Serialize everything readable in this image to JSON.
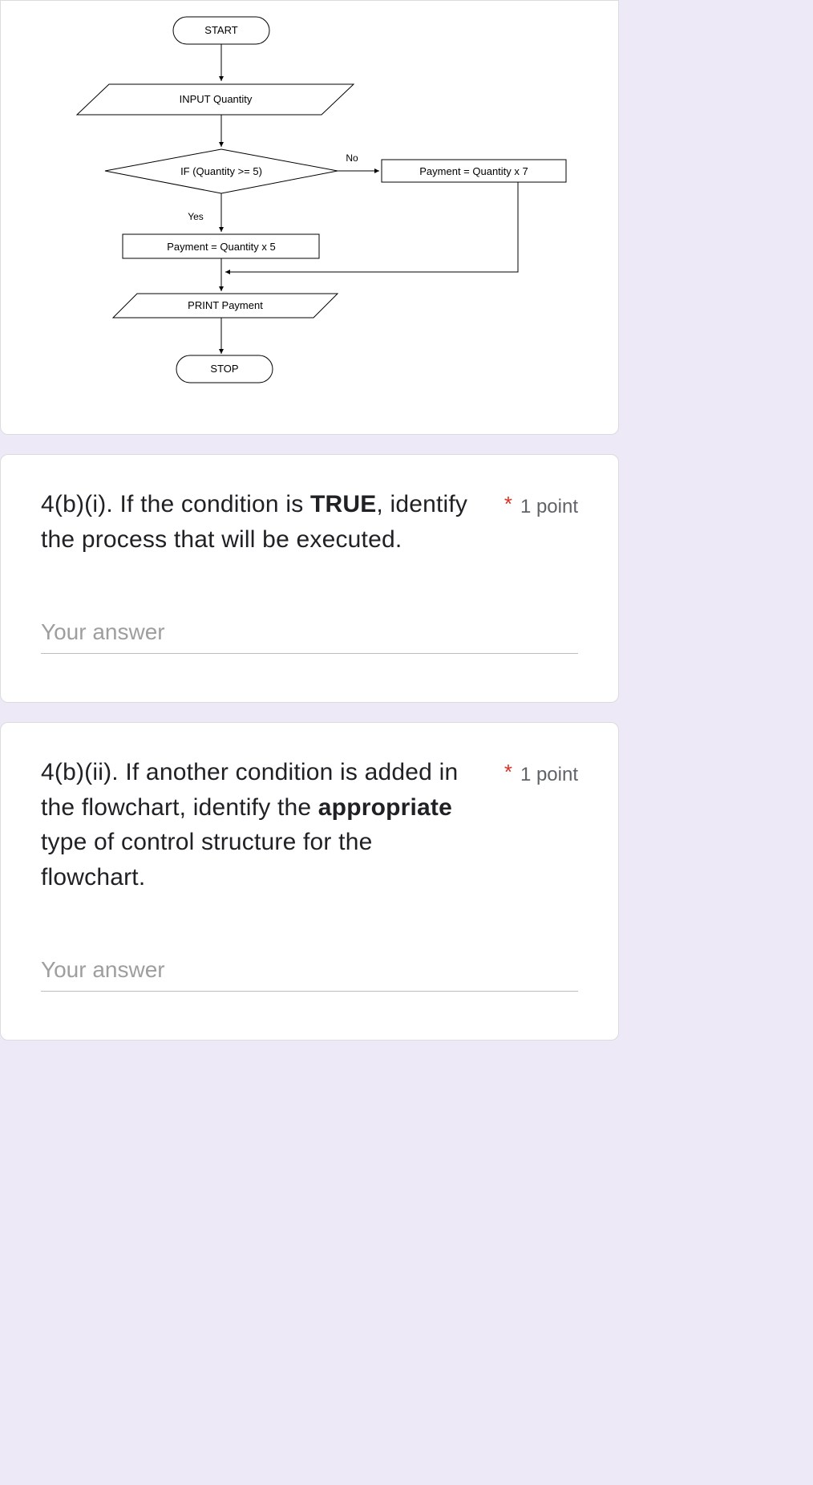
{
  "flowchart": {
    "start": "START",
    "input": "INPUT Quantity",
    "decision": "IF (Quantity >= 5)",
    "no_label": "No",
    "yes_label": "Yes",
    "proc_yes": "Payment = Quantity x 5",
    "proc_no": "Payment = Quantity x 7",
    "output": "PRINT Payment",
    "stop": "STOP"
  },
  "questions": {
    "q1": {
      "prefix": "4(b)(i). If the condition is ",
      "bold": "TRUE",
      "suffix": ", identify the process that will be executed.",
      "points": "1 point",
      "placeholder": "Your answer"
    },
    "q2": {
      "prefix": "4(b)(ii). If another condition is added in the flowchart, identify the ",
      "bold": "appropriate",
      "suffix": " type of control structure for the flowchart.",
      "points": "1 point",
      "placeholder": "Your answer"
    }
  }
}
